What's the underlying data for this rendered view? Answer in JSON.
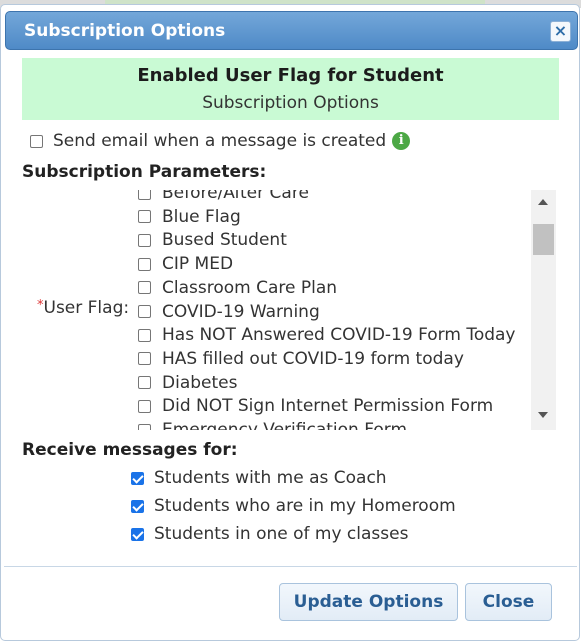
{
  "dialog": {
    "title": "Subscription Options",
    "close_label": "×"
  },
  "banner": {
    "title": "Enabled User Flag for Student",
    "subtitle": "Subscription Options"
  },
  "send_email": {
    "label": "Send email when a message is created",
    "checked": false,
    "info_glyph": "i"
  },
  "parameters": {
    "heading": "Subscription Parameters:",
    "user_flag_required_mark": "*",
    "user_flag_label": "User Flag:",
    "flags": [
      {
        "label": "Before/After Care",
        "checked": false
      },
      {
        "label": "Blue Flag",
        "checked": false
      },
      {
        "label": "Bused Student",
        "checked": false
      },
      {
        "label": "CIP MED",
        "checked": false
      },
      {
        "label": "Classroom Care Plan",
        "checked": false
      },
      {
        "label": "COVID-19 Warning",
        "checked": false
      },
      {
        "label": "Has NOT Answered COVID-19 Form Today",
        "checked": false
      },
      {
        "label": "HAS filled out COVID-19 form today",
        "checked": false
      },
      {
        "label": "Diabetes",
        "checked": false
      },
      {
        "label": "Did NOT Sign Internet Permission Form",
        "checked": false
      },
      {
        "label": "Emergency Verification Form",
        "checked": false
      }
    ]
  },
  "receive": {
    "heading": "Receive messages for:",
    "options": [
      {
        "label": "Students with me as Coach",
        "checked": true
      },
      {
        "label": "Students who are in my Homeroom",
        "checked": true
      },
      {
        "label": "Students in one of my classes",
        "checked": true
      }
    ]
  },
  "buttons": {
    "update": "Update Options",
    "close": "Close"
  }
}
